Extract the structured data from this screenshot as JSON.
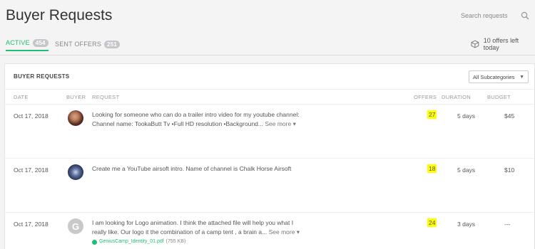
{
  "header": {
    "title": "Buyer Requests",
    "search_placeholder": "Search requests"
  },
  "tabs": [
    {
      "label": "ACTIVE",
      "count": "454",
      "active": true
    },
    {
      "label": "SENT OFFERS",
      "count": "251",
      "active": false
    }
  ],
  "offers_left": "10 offers left today",
  "panel": {
    "title": "BUYER REQUESTS",
    "subcategory_selected": "All Subcategories",
    "columns": {
      "date": "DATE",
      "buyer": "BUYER",
      "request": "REQUEST",
      "offers": "OFFERS",
      "duration": "DURATION",
      "budget": "BUDGET"
    }
  },
  "rows": [
    {
      "date": "Oct 17, 2018",
      "avatar": "photo-avatar",
      "request_line1": "Looking for someone who can do a trailer intro video for my youtube channel:",
      "request_line2": "Channel name: TookaButt Tv •Full HD resolution •Background...",
      "see_more": "See more ▾",
      "offers": "27",
      "duration": "5 days",
      "budget": "$45"
    },
    {
      "date": "Oct 17, 2018",
      "avatar": "photo-avatar",
      "request_line1": "Create me a YouTube airsoft intro. Name of channel is Chalk Horse Airsoft",
      "offers": "18",
      "duration": "5 days",
      "budget": "$10"
    },
    {
      "date": "Oct 17, 2018",
      "avatar": "letter-avatar",
      "avatar_letter": "G",
      "request_line1": "I am looking for Logo animation. I think the attached file will help you what I",
      "request_line2": "really like. Our logo it the combination of a camp tent , a brain a...",
      "see_more": "See more ▾",
      "attachment_name": "GeniusCamp_Identity_01.pdf",
      "attachment_size": "(755 KB)",
      "offers": "24",
      "duration": "3 days",
      "budget": "---"
    }
  ],
  "colors": {
    "accent": "#1dbf73",
    "highlight": "#ffff00",
    "badge": "#c5c6c9"
  }
}
